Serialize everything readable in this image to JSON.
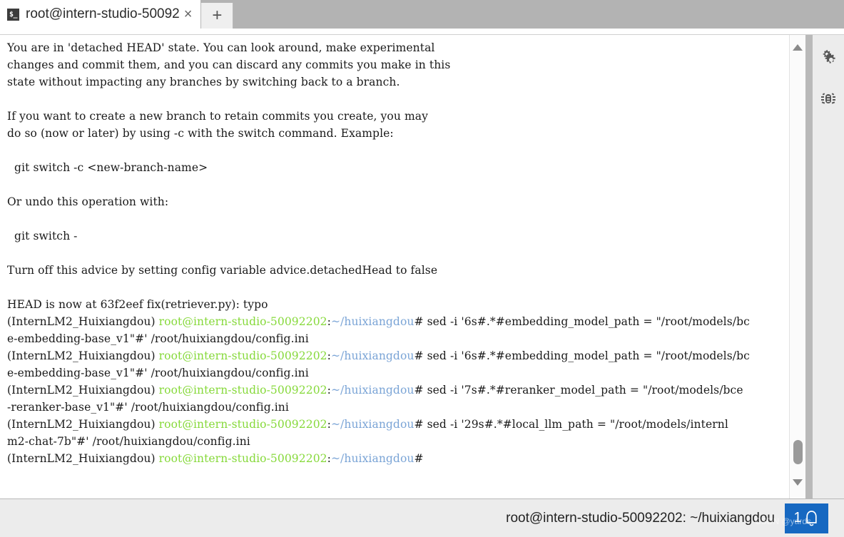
{
  "window": {
    "tab": {
      "title": "root@intern-studio-50092",
      "icon": "terminal-prompt-icon",
      "icon_glyph": "$_",
      "close_glyph": "×"
    },
    "new_tab_label": "+"
  },
  "colors": {
    "prompt_green": "#86d93a",
    "path_cyan": "#7aa4d6",
    "text": "#1a1a1a",
    "tabbar_bg": "#b3b3b3",
    "statusbar_bg": "#ececec",
    "notification_badge": "#1668c1"
  },
  "terminal": {
    "lines": [
      {
        "id": "l1",
        "segments": [
          {
            "color": "plain",
            "text": "You are in 'detached HEAD' state. You can look around, make experimental"
          }
        ]
      },
      {
        "id": "l2",
        "segments": [
          {
            "color": "plain",
            "text": "changes and commit them, and you can discard any commits you make in this"
          }
        ]
      },
      {
        "id": "l3",
        "segments": [
          {
            "color": "plain",
            "text": "state without impacting any branches by switching back to a branch."
          }
        ]
      },
      {
        "id": "l4",
        "segments": [
          {
            "color": "plain",
            "text": ""
          }
        ]
      },
      {
        "id": "l5",
        "segments": [
          {
            "color": "plain",
            "text": "If you want to create a new branch to retain commits you create, you may"
          }
        ]
      },
      {
        "id": "l6",
        "segments": [
          {
            "color": "plain",
            "text": "do so (now or later) by using -c with the switch command. Example:"
          }
        ]
      },
      {
        "id": "l7",
        "segments": [
          {
            "color": "plain",
            "text": ""
          }
        ]
      },
      {
        "id": "l8",
        "segments": [
          {
            "color": "plain",
            "text": "  git switch -c <new-branch-name>"
          }
        ]
      },
      {
        "id": "l9",
        "segments": [
          {
            "color": "plain",
            "text": ""
          }
        ]
      },
      {
        "id": "l10",
        "segments": [
          {
            "color": "plain",
            "text": "Or undo this operation with:"
          }
        ]
      },
      {
        "id": "l11",
        "segments": [
          {
            "color": "plain",
            "text": ""
          }
        ]
      },
      {
        "id": "l12",
        "segments": [
          {
            "color": "plain",
            "text": "  git switch -"
          }
        ]
      },
      {
        "id": "l13",
        "segments": [
          {
            "color": "plain",
            "text": ""
          }
        ]
      },
      {
        "id": "l14",
        "segments": [
          {
            "color": "plain",
            "text": "Turn off this advice by setting config variable advice.detachedHead to false"
          }
        ]
      },
      {
        "id": "l15",
        "segments": [
          {
            "color": "plain",
            "text": ""
          }
        ]
      },
      {
        "id": "l16",
        "segments": [
          {
            "color": "plain",
            "text": "HEAD is now at 63f2eef fix(retriever.py): typo"
          }
        ]
      },
      {
        "id": "l17",
        "segments": [
          {
            "color": "plain",
            "text": "(InternLM2_Huixiangdou) "
          },
          {
            "color": "green",
            "text": "root@intern-studio-50092202"
          },
          {
            "color": "plain",
            "text": ":"
          },
          {
            "color": "cyan",
            "text": "~/huixiangdou"
          },
          {
            "color": "plain",
            "text": "# sed -i '6s#.*#embedding_model_path = \"/root/models/bc"
          }
        ]
      },
      {
        "id": "l18",
        "segments": [
          {
            "color": "plain",
            "text": "e-embedding-base_v1\"#' /root/huixiangdou/config.ini"
          }
        ]
      },
      {
        "id": "l19",
        "segments": [
          {
            "color": "plain",
            "text": "(InternLM2_Huixiangdou) "
          },
          {
            "color": "green",
            "text": "root@intern-studio-50092202"
          },
          {
            "color": "plain",
            "text": ":"
          },
          {
            "color": "cyan",
            "text": "~/huixiangdou"
          },
          {
            "color": "plain",
            "text": "# sed -i '6s#.*#embedding_model_path = \"/root/models/bc"
          }
        ]
      },
      {
        "id": "l20",
        "segments": [
          {
            "color": "plain",
            "text": "e-embedding-base_v1\"#' /root/huixiangdou/config.ini"
          }
        ]
      },
      {
        "id": "l21",
        "segments": [
          {
            "color": "plain",
            "text": "(InternLM2_Huixiangdou) "
          },
          {
            "color": "green",
            "text": "root@intern-studio-50092202"
          },
          {
            "color": "plain",
            "text": ":"
          },
          {
            "color": "cyan",
            "text": "~/huixiangdou"
          },
          {
            "color": "plain",
            "text": "# sed -i '7s#.*#reranker_model_path = \"/root/models/bce"
          }
        ]
      },
      {
        "id": "l22",
        "segments": [
          {
            "color": "plain",
            "text": "-reranker-base_v1\"#' /root/huixiangdou/config.ini"
          }
        ]
      },
      {
        "id": "l23",
        "segments": [
          {
            "color": "plain",
            "text": "(InternLM2_Huixiangdou) "
          },
          {
            "color": "green",
            "text": "root@intern-studio-50092202"
          },
          {
            "color": "plain",
            "text": ":"
          },
          {
            "color": "cyan",
            "text": "~/huixiangdou"
          },
          {
            "color": "plain",
            "text": "# sed -i '29s#.*#local_llm_path = \"/root/models/internl"
          }
        ]
      },
      {
        "id": "l24",
        "segments": [
          {
            "color": "plain",
            "text": "m2-chat-7b\"#' /root/huixiangdou/config.ini"
          }
        ]
      },
      {
        "id": "l25",
        "segments": [
          {
            "color": "plain",
            "text": "(InternLM2_Huixiangdou) "
          },
          {
            "color": "green",
            "text": "root@intern-studio-50092202"
          },
          {
            "color": "plain",
            "text": ":"
          },
          {
            "color": "cyan",
            "text": "~/huixiangdou"
          },
          {
            "color": "plain",
            "text": "#"
          }
        ]
      }
    ]
  },
  "scrollbar": {
    "up_arrow": "scroll-up-arrow",
    "down_arrow": "scroll-down-arrow",
    "thumb": "scrollbar-thumb"
  },
  "rail": {
    "items": [
      {
        "icon": "settings-gears-icon"
      },
      {
        "icon": "bug-icon"
      }
    ]
  },
  "statusbar": {
    "title": "root@intern-studio-50092202: ~/huixiangdou",
    "notification_count": "1",
    "notification_icon": "bell-icon",
    "watermark": "CSDN @yards"
  }
}
